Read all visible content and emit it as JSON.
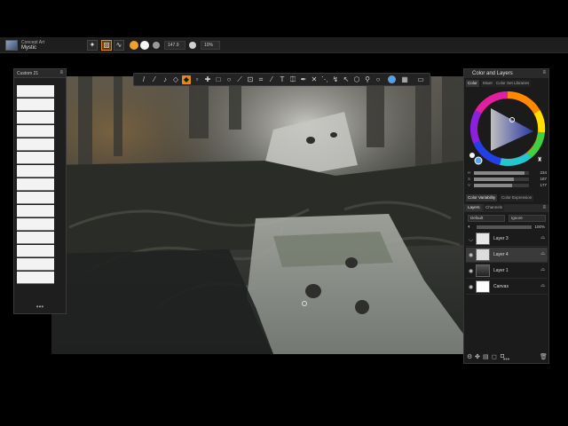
{
  "header": {
    "category": "Concept Art",
    "name": "Mystic"
  },
  "property_bar": {
    "size_value": "147.9",
    "opacity_value": "10%",
    "color_primary": "#f0a030",
    "color_secondary": "#f4f4f4"
  },
  "toolbar": {
    "tools": [
      "brush-icon",
      "pencil-icon",
      "eyedropper-icon",
      "eraser-icon",
      "fill-icon",
      "layer-adjust-icon",
      "move-icon",
      "rect-select-icon",
      "lasso-icon",
      "magic-wand-icon",
      "transform-icon",
      "crop-icon",
      "text-icon",
      "ruler-icon",
      "symmetry-icon",
      "clone-icon",
      "smudge-icon",
      "dodge-icon",
      "burn-icon",
      "zoom-icon",
      "grab-icon",
      "rotate-icon",
      "color-blend-icon",
      "grid-icon",
      "screen-icon"
    ]
  },
  "brushes": {
    "title": "Custom 21",
    "more": "•••"
  },
  "color_panel": {
    "title": "Color and Layers",
    "tabs": [
      "Color",
      "Mixer",
      "Color Set Libraries"
    ],
    "h_label": "H",
    "s_label": "S",
    "v_label": "V",
    "h_value": "234",
    "s_value": "187",
    "v_value": "177",
    "h_fraction": 0.92,
    "s_fraction": 0.73,
    "v_fraction": 0.69,
    "sub_tabs": [
      "Color Variability",
      "Color Expression"
    ]
  },
  "layers_panel": {
    "tabs": [
      "Layers",
      "Channels"
    ],
    "composite": "Default",
    "blend": "Ignore",
    "opacity": "100%",
    "layers": [
      {
        "name": "Layer 3",
        "selected": false,
        "visible": true
      },
      {
        "name": "Layer 4",
        "selected": true,
        "visible": true
      },
      {
        "name": "Layer 1",
        "selected": false,
        "visible": true
      },
      {
        "name": "Canvas",
        "selected": false,
        "visible": true
      }
    ],
    "more": "•••"
  }
}
